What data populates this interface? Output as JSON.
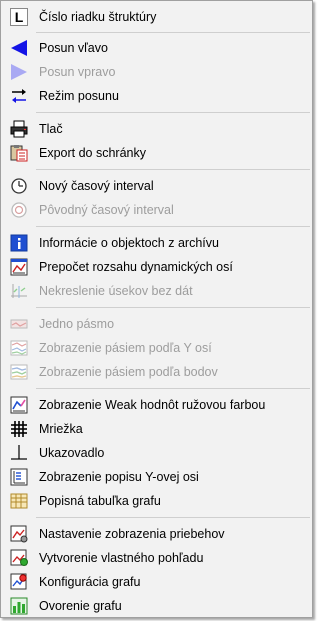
{
  "menu": {
    "items": [
      {
        "label": "Číslo riadku štruktúry",
        "icon": "letter-l-icon",
        "enabled": true
      },
      {
        "label": "Posun vľavo",
        "icon": "arrow-left-icon",
        "enabled": true
      },
      {
        "label": "Posun vpravo",
        "icon": "arrow-right-icon",
        "enabled": false
      },
      {
        "label": "Režim posunu",
        "icon": "move-arrows-icon",
        "enabled": true
      },
      {
        "label": "Tlač",
        "icon": "printer-icon",
        "enabled": true
      },
      {
        "label": "Export do schránky",
        "icon": "clipboard-export-icon",
        "enabled": true
      },
      {
        "label": "Nový časový interval",
        "icon": "clock-icon",
        "enabled": true
      },
      {
        "label": "Pôvodný časový interval",
        "icon": "clock-reset-icon",
        "enabled": false
      },
      {
        "label": "Informácie o objektoch z archívu",
        "icon": "info-icon",
        "enabled": true
      },
      {
        "label": "Prepočet rozsahu dynamických osí",
        "icon": "axis-rescale-icon",
        "enabled": true
      },
      {
        "label": "Nekreslenie úsekov bez dát",
        "icon": "gap-chart-icon",
        "enabled": false
      },
      {
        "label": "Jedno pásmo",
        "icon": "single-band-icon",
        "enabled": false
      },
      {
        "label": "Zobrazenie pásiem podľa Y osí",
        "icon": "bands-y-axis-icon",
        "enabled": false
      },
      {
        "label": "Zobrazenie pásiem podľa bodov",
        "icon": "bands-points-icon",
        "enabled": false
      },
      {
        "label": "Zobrazenie Weak hodnôt ružovou farbou",
        "icon": "weak-values-icon",
        "enabled": true
      },
      {
        "label": "Mriežka",
        "icon": "grid-icon",
        "enabled": true
      },
      {
        "label": "Ukazovadlo",
        "icon": "pointer-crosshair-icon",
        "enabled": true
      },
      {
        "label": "Zobrazenie popisu Y-ovej osi",
        "icon": "y-axis-label-icon",
        "enabled": true
      },
      {
        "label": "Popisná tabuľka grafu",
        "icon": "legend-table-icon",
        "enabled": true
      },
      {
        "label": "Nastavenie zobrazenia priebehov",
        "icon": "trend-settings-icon",
        "enabled": true
      },
      {
        "label": "Vytvorenie vlastného pohľadu",
        "icon": "custom-view-icon",
        "enabled": true
      },
      {
        "label": "Konfigurácia grafu",
        "icon": "chart-config-icon",
        "enabled": true
      },
      {
        "label": "Ovorenie grafu",
        "icon": "bar-chart-icon",
        "enabled": true
      }
    ],
    "colors": {
      "background": "#f2f2f2",
      "disabled_text": "#9d9d9d",
      "separator": "#cfcfcf",
      "arrow_blue": "#1414e6",
      "arrow_disabled": "#a9a9f3"
    }
  }
}
